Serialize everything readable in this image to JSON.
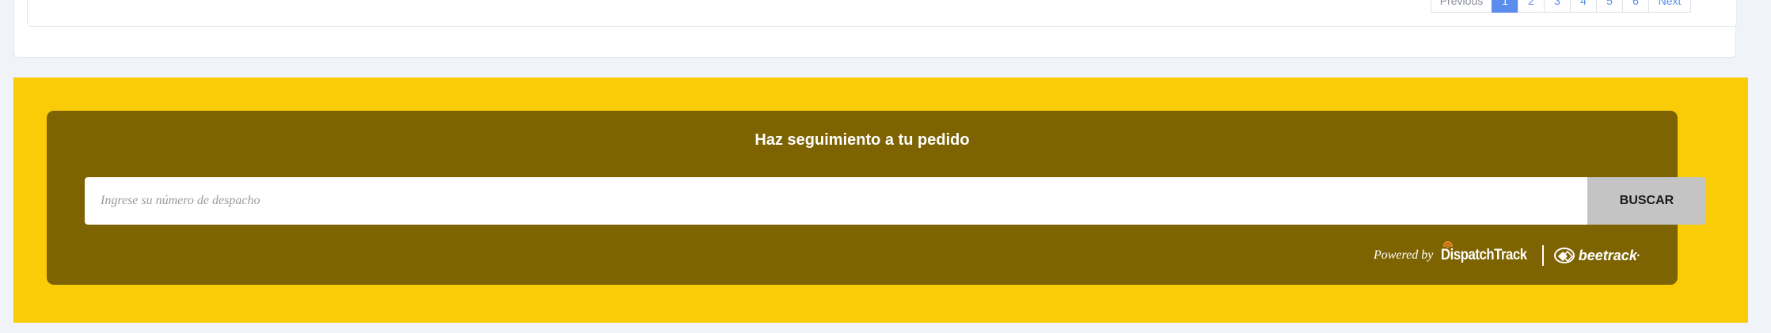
{
  "pagination": {
    "previous_label": "Previous",
    "pages": [
      "1",
      "2",
      "3",
      "4",
      "5",
      "6"
    ],
    "active_page": "1",
    "next_label": "Next"
  },
  "tracking": {
    "title": "Haz seguimiento a tu pedido",
    "search_placeholder": "Ingrese su número de despacho",
    "search_value": "",
    "search_button_label": "BUSCAR",
    "powered_by_label": "Powered by",
    "dispatchtrack_logo": "DispatchTrack",
    "beetrack_logo": "beetrack"
  },
  "colors": {
    "page_background": "#f0f3f7",
    "yellow_band": "#facb07",
    "tracking_box": "#7d6302",
    "search_button": "#c4c4c4",
    "pagination_active": "#5b8def",
    "pagination_link": "#5a8dee"
  }
}
